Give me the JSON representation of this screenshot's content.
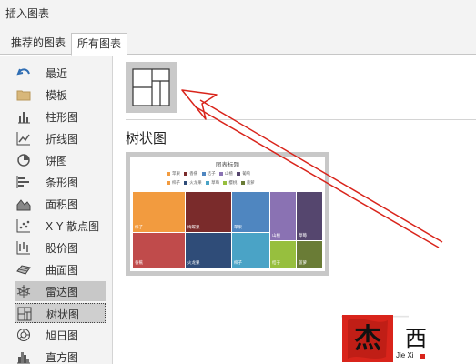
{
  "window": {
    "title": "插入图表"
  },
  "tabs": [
    {
      "label": "推荐的图表"
    },
    {
      "label": "所有图表"
    }
  ],
  "sidebar": {
    "items": [
      {
        "label": "最近",
        "icon": "undo-icon"
      },
      {
        "label": "模板",
        "icon": "folder-icon"
      },
      {
        "label": "柱形图",
        "icon": "column-chart-icon"
      },
      {
        "label": "折线图",
        "icon": "line-chart-icon"
      },
      {
        "label": "饼图",
        "icon": "pie-chart-icon"
      },
      {
        "label": "条形图",
        "icon": "bar-chart-icon"
      },
      {
        "label": "面积图",
        "icon": "area-chart-icon"
      },
      {
        "label": "X Y 散点图",
        "icon": "scatter-chart-icon"
      },
      {
        "label": "股价图",
        "icon": "stock-chart-icon"
      },
      {
        "label": "曲面图",
        "icon": "surface-chart-icon"
      },
      {
        "label": "雷达图",
        "icon": "radar-chart-icon"
      },
      {
        "label": "树状图",
        "icon": "treemap-chart-icon"
      },
      {
        "label": "旭日图",
        "icon": "sunburst-chart-icon"
      },
      {
        "label": "直方图",
        "icon": "histogram-chart-icon"
      }
    ],
    "selected": "树状图"
  },
  "main": {
    "subtype_icon": "treemap-icon",
    "section_title": "树状图",
    "preview": {
      "title": "图表标题",
      "legend_row1": [
        "苹果",
        "香蕉",
        "桔子",
        "山楂",
        "葡萄"
      ],
      "legend_row2": [
        "柿子",
        "火龙果",
        "草莓",
        "樱桃",
        "菠萝"
      ],
      "legend_colors": [
        "#f29b3f",
        "#7a2b2b",
        "#4f86c0",
        "#8a72b3",
        "#55466e",
        "#f29b3f",
        "#2f4c78",
        "#4aa3c6",
        "#97bf3e",
        "#6a7c36"
      ],
      "tiles": [
        {
          "label": "柿子",
          "color": "#f29b3f"
        },
        {
          "label": "香蕉",
          "color": "#c04b4b"
        },
        {
          "label": "梅蝶果",
          "color": "#7a2b2b"
        },
        {
          "label": "火龙果",
          "color": "#2f4c78"
        },
        {
          "label": "苹果",
          "color": "#4f86c0"
        },
        {
          "label": "柿子",
          "color": "#4aa3c6"
        },
        {
          "label": "山楂",
          "color": "#8a72b3"
        },
        {
          "label": "草莓",
          "color": "#55466e"
        },
        {
          "label": "桔子",
          "color": "#97bf3e"
        },
        {
          "label": "菠萝",
          "color": "#6a7c36"
        }
      ]
    }
  },
  "watermark": {
    "text": "西",
    "sub": "Jie Xi",
    "logo_char": "杰"
  },
  "colors": {
    "arrow": "#d9241b",
    "selected_bg": "#c8c8c8"
  }
}
